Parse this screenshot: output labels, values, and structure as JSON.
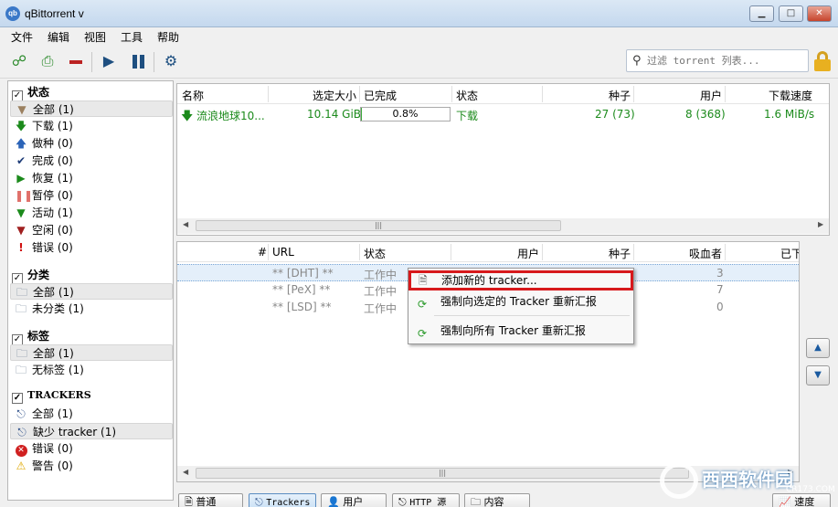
{
  "window": {
    "title": "qBittorrent v",
    "min": "▁",
    "max": "□",
    "close": "✕"
  },
  "menu": [
    "文件",
    "编辑",
    "视图",
    "工具",
    "帮助"
  ],
  "search": {
    "placeholder": "过滤 torrent 列表..."
  },
  "sidebar": {
    "status": {
      "title": "状态",
      "items": [
        {
          "icon": "filter-icon",
          "label": "全部 (1)",
          "selected": true
        },
        {
          "icon": "download-arrow-icon",
          "label": "下载 (1)"
        },
        {
          "icon": "upload-arrow-icon",
          "label": "做种 (0)"
        },
        {
          "icon": "check-icon",
          "label": "完成 (0)"
        },
        {
          "icon": "play-icon",
          "label": "恢复 (1)"
        },
        {
          "icon": "pause-icon",
          "label": "暂停 (0)"
        },
        {
          "icon": "active-filter-icon",
          "label": "活动 (1)"
        },
        {
          "icon": "inactive-filter-icon",
          "label": "空闲 (0)"
        },
        {
          "icon": "error-exclamation-icon",
          "label": "错误 (0)"
        }
      ]
    },
    "categories": {
      "title": "分类",
      "items": [
        {
          "icon": "folder-icon",
          "label": "全部 (1)",
          "selected": true
        },
        {
          "icon": "folder-icon",
          "label": "未分类 (1)"
        }
      ]
    },
    "tags": {
      "title": "标签",
      "items": [
        {
          "icon": "folder-icon",
          "label": "全部 (1)",
          "selected": true
        },
        {
          "icon": "folder-icon",
          "label": "无标签 (1)"
        }
      ]
    },
    "trackers": {
      "title": "TRACKERS",
      "items": [
        {
          "icon": "tracker-icon",
          "label": "全部 (1)"
        },
        {
          "icon": "tracker-icon",
          "label": "缺少 tracker (1)",
          "selected": true
        },
        {
          "icon": "error-icon",
          "label": "错误 (0)"
        },
        {
          "icon": "warning-icon",
          "label": "警告 (0)"
        }
      ]
    }
  },
  "torrents": {
    "headers": [
      "名称",
      "选定大小",
      "已完成",
      "状态",
      "种子",
      "用户",
      "下载速度"
    ],
    "rows": [
      {
        "name": "流浪地球10...",
        "size": "10.14 GiB",
        "progress": 0.8,
        "progress_text": "0.8%",
        "status": "下载",
        "seeds": "27 (73)",
        "peers": "8 (368)",
        "dl_speed": "1.6 MiB/s"
      }
    ]
  },
  "trackers_table": {
    "headers": [
      "#",
      "URL",
      "状态",
      "用户",
      "种子",
      "吸血者",
      "已下"
    ],
    "rows": [
      {
        "url": "** [DHT] **",
        "status": "工作中",
        "leechers": "3"
      },
      {
        "url": "** [PeX] **",
        "status": "工作中",
        "leechers": "7"
      },
      {
        "url": "** [LSD] **",
        "status": "工作中",
        "leechers": "0"
      }
    ]
  },
  "context_menu": [
    {
      "label": "添加新的 tracker...",
      "icon": "add-document-icon"
    },
    {
      "label": "强制向选定的 Tracker 重新汇报",
      "icon": "refresh-icon"
    },
    {
      "label": "强制向所有 Tracker 重新汇报",
      "icon": "refresh-icon"
    }
  ],
  "tabs": [
    {
      "label": "普通"
    },
    {
      "label": "Trackers",
      "active": true
    },
    {
      "label": "用户"
    },
    {
      "label": "HTTP 源"
    },
    {
      "label": "内容"
    },
    {
      "label": "速度"
    }
  ],
  "watermark": {
    "text": "西西软件园",
    "url": "CR173.COM"
  },
  "colors": {
    "downloading": "#1b8a1b",
    "highlight_border": "#d7191c"
  }
}
